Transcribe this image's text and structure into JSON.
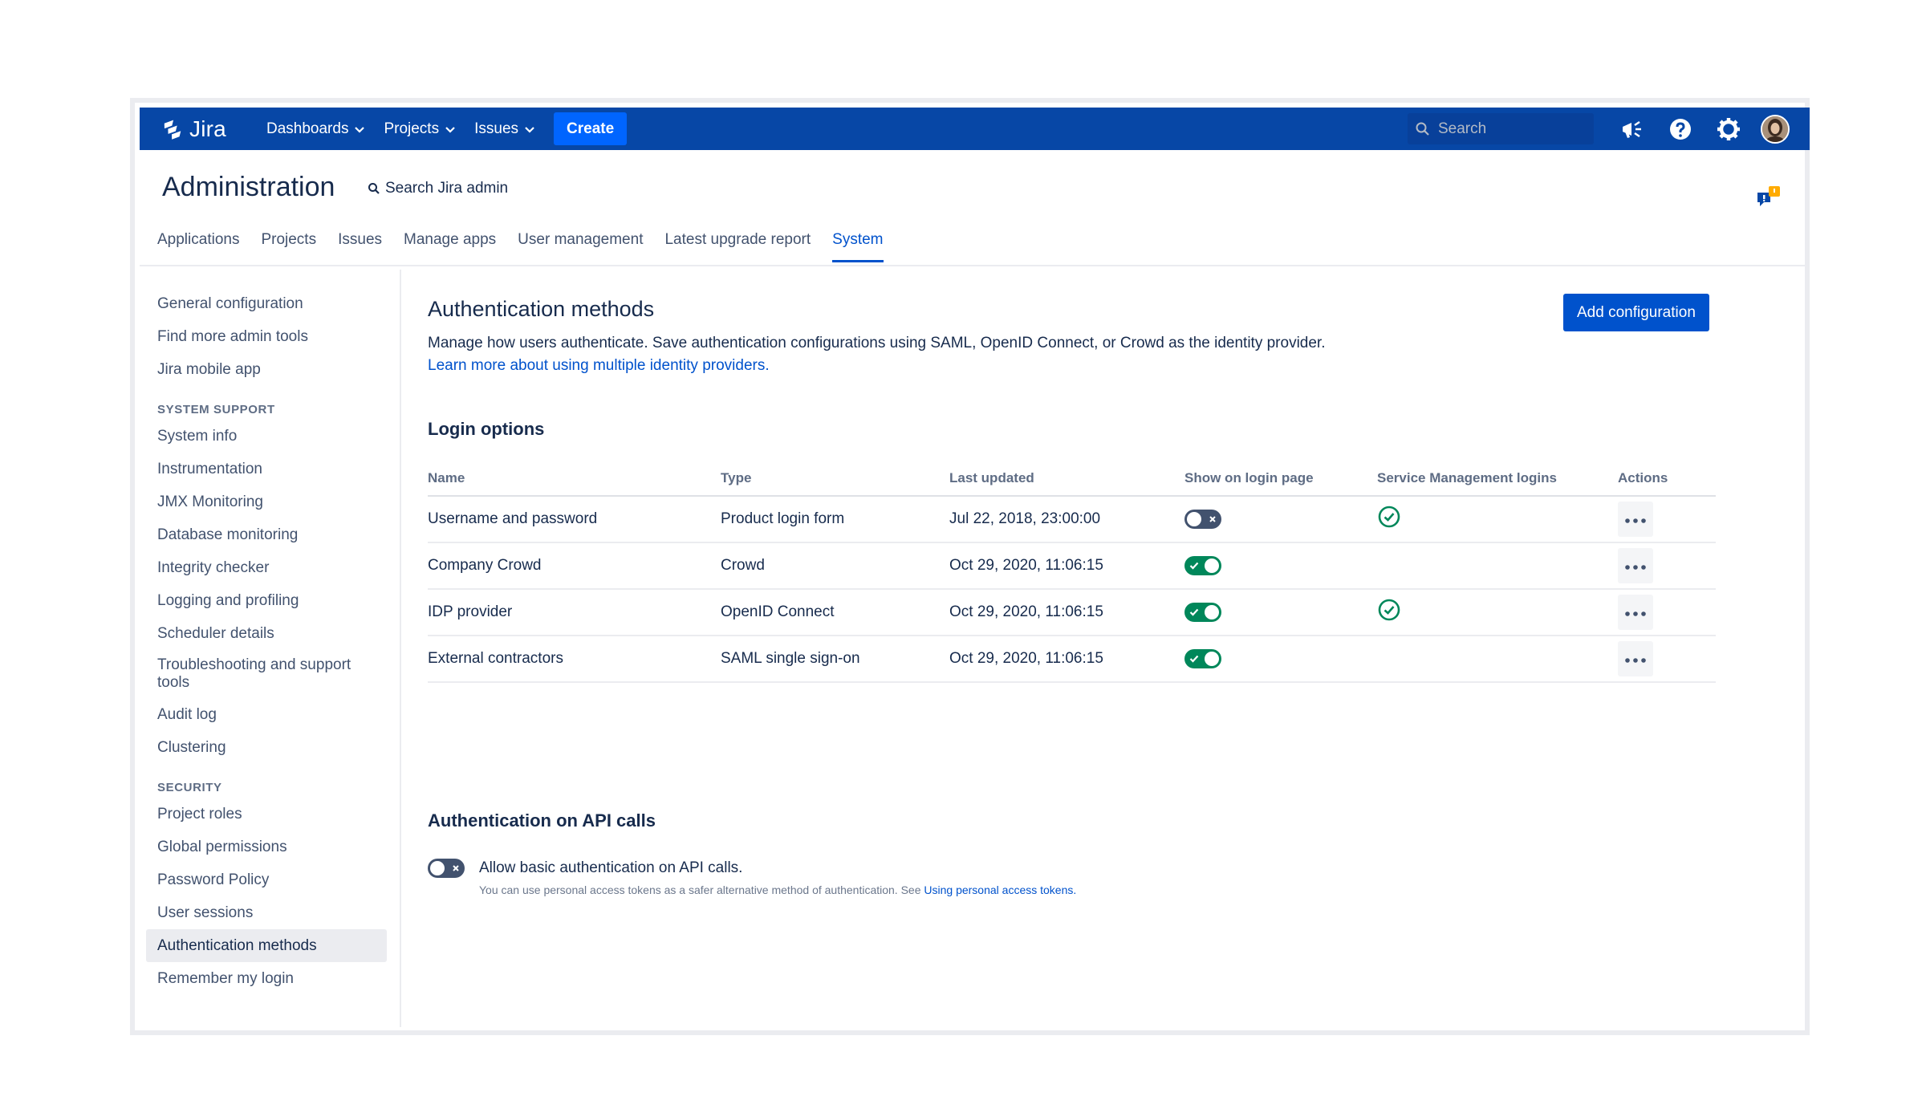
{
  "nav": {
    "logo_text": "Jira",
    "links": [
      {
        "label": "Dashboards"
      },
      {
        "label": "Projects"
      },
      {
        "label": "Issues"
      }
    ],
    "create_label": "Create",
    "search_placeholder": "Search"
  },
  "admin": {
    "title": "Administration",
    "search_label": "Search Jira admin",
    "tabs": [
      {
        "label": "Applications"
      },
      {
        "label": "Projects"
      },
      {
        "label": "Issues"
      },
      {
        "label": "Manage apps"
      },
      {
        "label": "User management"
      },
      {
        "label": "Latest upgrade report"
      },
      {
        "label": "System",
        "active": true
      }
    ]
  },
  "sidebar": {
    "top_items": [
      "General configuration",
      "Find more admin tools",
      "Jira mobile app"
    ],
    "system_support_heading": "SYSTEM SUPPORT",
    "system_support_items": [
      "System info",
      "Instrumentation",
      "JMX Monitoring",
      "Database monitoring",
      "Integrity checker",
      "Logging and profiling",
      "Scheduler details",
      "Troubleshooting and support tools",
      "Audit log",
      "Clustering"
    ],
    "security_heading": "SECURITY",
    "security_items": [
      "Project roles",
      "Global permissions",
      "Password Policy",
      "User sessions",
      "Authentication methods",
      "Remember my login"
    ]
  },
  "main": {
    "title": "Authentication methods",
    "add_button": "Add configuration",
    "description": "Manage how users authenticate. Save authentication configurations using SAML, OpenID Connect, or Crowd as the identity provider.",
    "learn_more": "Learn more about using multiple identity providers.",
    "login_options_title": "Login options",
    "columns": [
      "Name",
      "Type",
      "Last updated",
      "Show on login page",
      "Service Management logins",
      "Actions"
    ],
    "rows": [
      {
        "name": "Username and password",
        "type": "Product login form",
        "updated": "Jul 22, 2018, 23:00:00",
        "show": false,
        "sm": true
      },
      {
        "name": "Company Crowd",
        "type": "Crowd",
        "updated": "Oct 29, 2020, 11:06:15",
        "show": true,
        "sm": false
      },
      {
        "name": "IDP provider",
        "type": "OpenID Connect",
        "updated": "Oct 29, 2020, 11:06:15",
        "show": true,
        "sm": true
      },
      {
        "name": "External contractors",
        "type": "SAML single sign-on",
        "updated": "Oct 29, 2020, 11:06:15",
        "show": true,
        "sm": false
      }
    ],
    "api_title": "Authentication on API calls",
    "api_toggle_on": false,
    "api_label": "Allow basic authentication on API calls.",
    "api_help": "You can use personal access tokens as a safer alternative method of authentication. See ",
    "api_help_link": "Using personal access tokens."
  },
  "colors": {
    "nav_bg": "#0747a6",
    "primary": "#0052cc",
    "success": "#00875a",
    "toggle_off": "#42526e"
  }
}
